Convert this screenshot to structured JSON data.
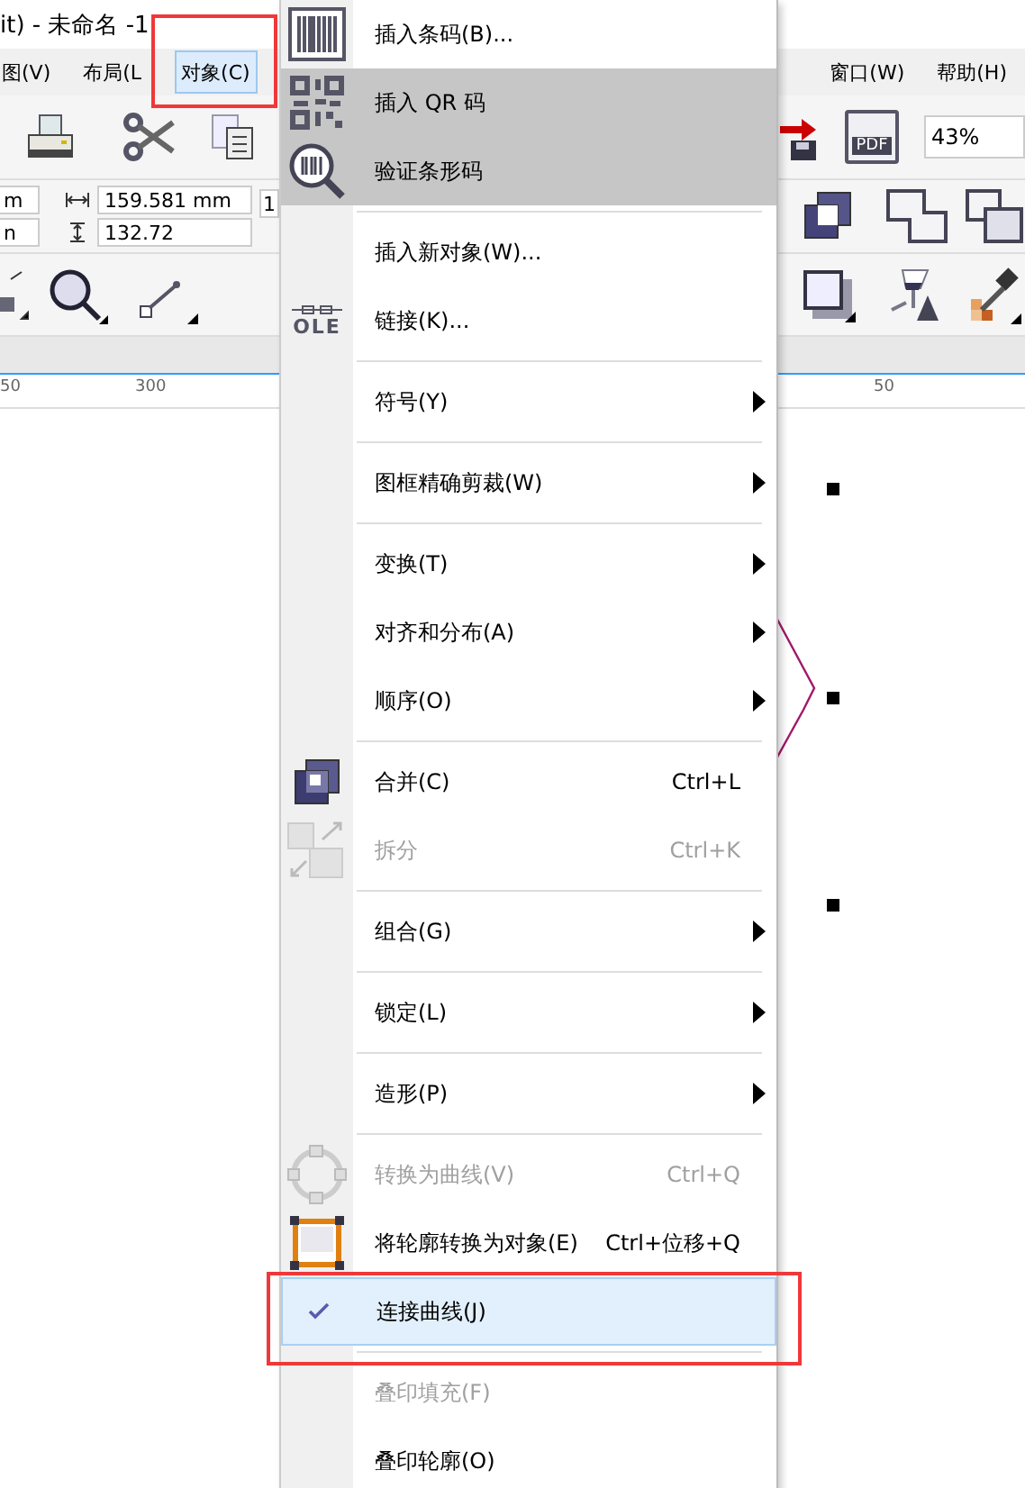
{
  "window": {
    "title": "it) - 未命名 -1"
  },
  "menubar": [
    {
      "label": "图(V)",
      "selected": false
    },
    {
      "label": "布局(L",
      "selected": false
    },
    {
      "label": "对象(C)",
      "selected": true
    },
    {
      "label": "窗口(W)",
      "selected": false
    },
    {
      "label": "帮助(H)",
      "selected": false
    }
  ],
  "toolbar": {
    "pdf_label": "PDF",
    "zoom": "43%"
  },
  "property_bar": {
    "fields": [
      "m",
      "n",
      "159.581 mm",
      "132.72",
      "1"
    ]
  },
  "ruler": {
    "labels": [
      "50",
      "300",
      "50"
    ]
  },
  "menu": {
    "items": [
      {
        "kind": "item",
        "label": "插入条码(B)...",
        "submenu": false,
        "disabled": false,
        "checked": false,
        "shaded": false,
        "selected": false
      },
      {
        "kind": "item",
        "label": "插入 QR 码",
        "submenu": false,
        "disabled": false,
        "checked": false,
        "shaded": true,
        "selected": false
      },
      {
        "kind": "item",
        "label": "验证条形码",
        "submenu": false,
        "disabled": false,
        "checked": false,
        "shaded": true,
        "selected": false
      },
      {
        "kind": "separator"
      },
      {
        "kind": "item",
        "label": "插入新对象(W)...",
        "submenu": false,
        "disabled": false,
        "checked": false,
        "shaded": false,
        "selected": false
      },
      {
        "kind": "item",
        "label": "链接(K)...",
        "icon_text": "OLE",
        "submenu": false,
        "disabled": false,
        "checked": false,
        "shaded": false,
        "selected": false
      },
      {
        "kind": "separator"
      },
      {
        "kind": "item",
        "label": "符号(Y)",
        "submenu": true,
        "disabled": false,
        "checked": false,
        "shaded": false,
        "selected": false
      },
      {
        "kind": "separator"
      },
      {
        "kind": "item",
        "label": "图框精确剪裁(W)",
        "submenu": true,
        "disabled": false,
        "checked": false,
        "shaded": false,
        "selected": false
      },
      {
        "kind": "separator"
      },
      {
        "kind": "item",
        "label": "变换(T)",
        "submenu": true,
        "disabled": false,
        "checked": false,
        "shaded": false,
        "selected": false
      },
      {
        "kind": "item",
        "label": "对齐和分布(A)",
        "submenu": true,
        "disabled": false,
        "checked": false,
        "shaded": false,
        "selected": false
      },
      {
        "kind": "item",
        "label": "顺序(O)",
        "submenu": true,
        "disabled": false,
        "checked": false,
        "shaded": false,
        "selected": false
      },
      {
        "kind": "separator"
      },
      {
        "kind": "item",
        "label": "合并(C)",
        "shortcut": "Ctrl+L",
        "submenu": false,
        "disabled": false,
        "checked": false,
        "shaded": false,
        "selected": false
      },
      {
        "kind": "item",
        "label": "拆分",
        "shortcut": "Ctrl+K",
        "submenu": false,
        "disabled": true,
        "checked": false,
        "shaded": false,
        "selected": false
      },
      {
        "kind": "separator"
      },
      {
        "kind": "item",
        "label": "组合(G)",
        "submenu": true,
        "disabled": false,
        "checked": false,
        "shaded": false,
        "selected": false
      },
      {
        "kind": "separator"
      },
      {
        "kind": "item",
        "label": "锁定(L)",
        "submenu": true,
        "disabled": false,
        "checked": false,
        "shaded": false,
        "selected": false
      },
      {
        "kind": "separator"
      },
      {
        "kind": "item",
        "label": "造形(P)",
        "submenu": true,
        "disabled": false,
        "checked": false,
        "shaded": false,
        "selected": false
      },
      {
        "kind": "separator"
      },
      {
        "kind": "item",
        "label": "转换为曲线(V)",
        "shortcut": "Ctrl+Q",
        "submenu": false,
        "disabled": true,
        "checked": false,
        "shaded": false,
        "selected": false
      },
      {
        "kind": "item",
        "label": "将轮廓转换为对象(E)",
        "shortcut": "Ctrl+位移+Q",
        "submenu": false,
        "disabled": false,
        "checked": false,
        "shaded": false,
        "selected": false
      },
      {
        "kind": "item",
        "label": "连接曲线(J)",
        "submenu": false,
        "disabled": false,
        "checked": true,
        "shaded": false,
        "selected": true
      },
      {
        "kind": "separator"
      },
      {
        "kind": "item",
        "label": "叠印填充(F)",
        "submenu": false,
        "disabled": true,
        "checked": false,
        "shaded": false,
        "selected": false
      },
      {
        "kind": "item",
        "label": "叠印轮廓(O)",
        "submenu": false,
        "disabled": false,
        "checked": false,
        "shaded": false,
        "selected": false
      }
    ]
  }
}
